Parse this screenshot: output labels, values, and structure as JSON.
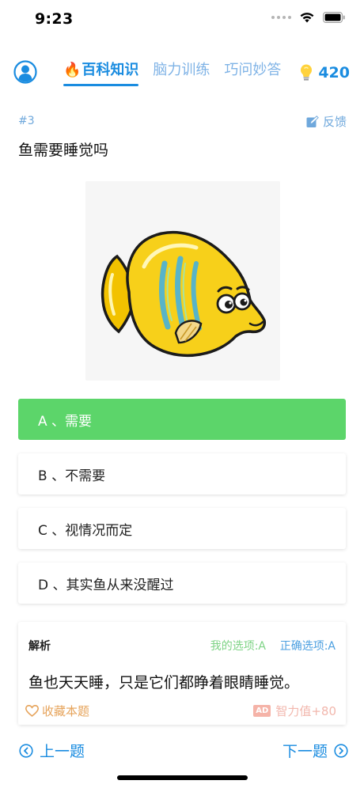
{
  "status_bar": {
    "time": "9:23"
  },
  "header": {
    "tabs": [
      {
        "label": "百科知识",
        "active": true
      },
      {
        "label": "脑力训练",
        "active": false
      },
      {
        "label": "巧问妙答",
        "active": false
      }
    ],
    "points": "420",
    "colors": {
      "accent": "#1a8ce0",
      "inactive_tab": "#7fb3e6"
    }
  },
  "question": {
    "number": "#3",
    "feedback_label": "反馈",
    "text": "鱼需要睡觉吗",
    "image": "cartoon-yellow-fish"
  },
  "options": [
    {
      "label": "A 、需要",
      "state": "correct"
    },
    {
      "label": "B 、不需要",
      "state": "normal"
    },
    {
      "label": "C 、视情况而定",
      "state": "normal"
    },
    {
      "label": "D 、其实鱼从来没醒过",
      "state": "normal"
    }
  ],
  "analysis": {
    "title": "解析",
    "my_choice": "我的选项:A",
    "correct_choice": "正确选项:A",
    "text": "鱼也天天睡，只是它们都睁着眼睛睡觉。",
    "collect_label": "收藏本题",
    "ad_badge": "AD",
    "reward_label": "智力值+80"
  },
  "nav": {
    "prev_label": "上一题",
    "next_label": "下一题"
  },
  "colors": {
    "correct": "#5cd56a",
    "favorite": "#e6a35a"
  }
}
